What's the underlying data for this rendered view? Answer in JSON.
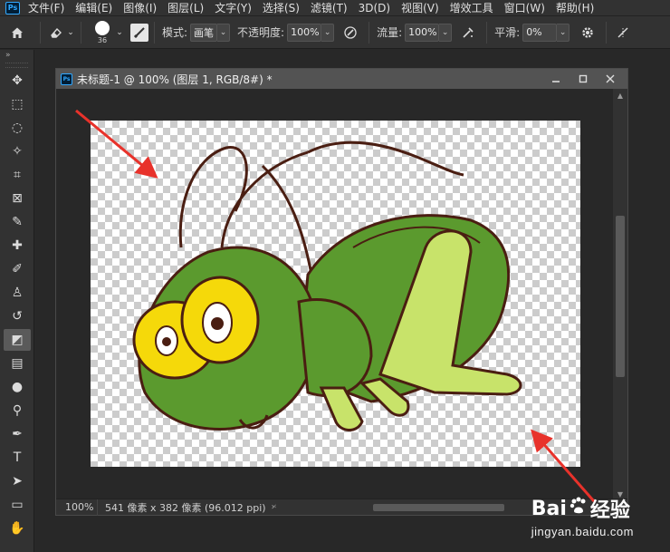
{
  "app": {
    "logo_text": "Ps"
  },
  "menubar": {
    "items": [
      "文件(F)",
      "编辑(E)",
      "图像(I)",
      "图层(L)",
      "文字(Y)",
      "选择(S)",
      "滤镜(T)",
      "3D(D)",
      "视图(V)",
      "增效工具",
      "窗口(W)",
      "帮助(H)"
    ]
  },
  "options": {
    "brush_size": "36",
    "mode_label": "模式:",
    "mode_value": "画笔",
    "opacity_label": "不透明度:",
    "opacity_value": "100%",
    "flow_label": "流量:",
    "flow_value": "100%",
    "smoothing_label": "平滑:",
    "smoothing_value": "0%"
  },
  "toolbar": {
    "collapse_glyph": "»",
    "tools": [
      {
        "name": "move-tool",
        "glyph": "✥"
      },
      {
        "name": "marquee-tool",
        "glyph": "⬚"
      },
      {
        "name": "lasso-tool",
        "glyph": "◌"
      },
      {
        "name": "magic-wand-tool",
        "glyph": "✧"
      },
      {
        "name": "crop-tool",
        "glyph": "⌗"
      },
      {
        "name": "frame-tool",
        "glyph": "⊠"
      },
      {
        "name": "eyedropper-tool",
        "glyph": "✎"
      },
      {
        "name": "healing-brush-tool",
        "glyph": "✚"
      },
      {
        "name": "brush-tool",
        "glyph": "✐"
      },
      {
        "name": "clone-stamp-tool",
        "glyph": "♙"
      },
      {
        "name": "history-brush-tool",
        "glyph": "↺"
      },
      {
        "name": "eraser-tool",
        "glyph": "◩",
        "active": true
      },
      {
        "name": "gradient-tool",
        "glyph": "▤"
      },
      {
        "name": "blur-tool",
        "glyph": "●"
      },
      {
        "name": "dodge-tool",
        "glyph": "⚲"
      },
      {
        "name": "pen-tool",
        "glyph": "✒"
      },
      {
        "name": "type-tool",
        "glyph": "T"
      },
      {
        "name": "path-selection-tool",
        "glyph": "➤"
      },
      {
        "name": "rectangle-tool",
        "glyph": "▭"
      },
      {
        "name": "hand-tool",
        "glyph": "✋"
      }
    ]
  },
  "document": {
    "title": "未标题-1 @ 100% (图层 1, RGB/8#) *",
    "zoom": "100%",
    "info": "541 像素 x 382 像素 (96.012 ppi)"
  },
  "watermark": {
    "logo_left": "Bai",
    "logo_right": "经验",
    "url": "jingyan.baidu.com"
  },
  "colors": {
    "annotation_arrow": "#e8322b",
    "grasshopper_dark": "#5b9a2e",
    "grasshopper_light": "#c8e36a",
    "eye_yellow": "#f5d90a"
  }
}
